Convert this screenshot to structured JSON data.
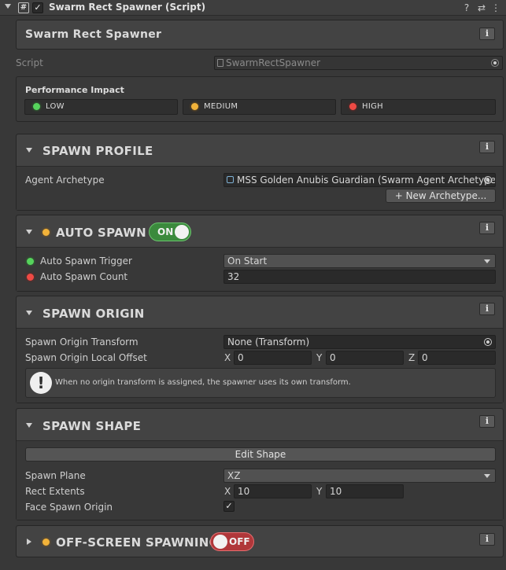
{
  "component": {
    "title": "Swarm Rect Spawner (Script)",
    "script_glyph": "#",
    "enabled_glyph": "✓",
    "icons": [
      "help-icon",
      "preset-icon",
      "menu-icon"
    ],
    "icon_glyphs": {
      "help": "?",
      "preset": "⇄",
      "menu": "⋮"
    }
  },
  "header_panel": {
    "title": "Swarm Rect Spawner",
    "info": "i"
  },
  "script_field": {
    "label": "Script",
    "value": "SwarmRectSpawner"
  },
  "performance": {
    "title": "Performance Impact",
    "levels": [
      {
        "label": "LOW",
        "color": "#56d35c"
      },
      {
        "label": "MEDIUM",
        "color": "#f2b33a"
      },
      {
        "label": "HIGH",
        "color": "#ee4a44"
      }
    ]
  },
  "sections": {
    "spawn_profile": {
      "title": "SPAWN PROFILE",
      "info": "i",
      "agent_archetype_label": "Agent Archetype",
      "agent_archetype_value": "MSS Golden Anubis Guardian (Swarm Agent Archetype)",
      "new_archetype_button": "+ New Archetype..."
    },
    "auto_spawn": {
      "title": "AUTO SPAWN",
      "info": "i",
      "toggle_label": "ON",
      "toggle_state": true,
      "trigger_label": "Auto Spawn Trigger",
      "trigger_value": "On Start",
      "count_label": "Auto Spawn Count",
      "count_value": "32"
    },
    "spawn_origin": {
      "title": "SPAWN ORIGIN",
      "info": "i",
      "transform_label": "Spawn Origin Transform",
      "transform_value": "None (Transform)",
      "offset_label": "Spawn Origin Local Offset",
      "offset": {
        "x_label": "X",
        "x": "0",
        "y_label": "Y",
        "y": "0",
        "z_label": "Z",
        "z": "0"
      },
      "help_glyph": "!",
      "help_text": "When no origin transform is assigned, the spawner uses its own transform."
    },
    "spawn_shape": {
      "title": "SPAWN SHAPE",
      "info": "i",
      "edit_shape_button": "Edit Shape",
      "plane_label": "Spawn Plane",
      "plane_value": "XZ",
      "extents_label": "Rect Extents",
      "extents": {
        "x_label": "X",
        "x": "10",
        "y_label": "Y",
        "y": "10"
      },
      "face_origin_label": "Face Spawn Origin",
      "face_origin_checked": true,
      "check_glyph": "✓"
    },
    "offscreen": {
      "title": "OFF-SCREEN SPAWNING",
      "info": "i",
      "toggle_label": "OFF",
      "toggle_state": false
    }
  }
}
